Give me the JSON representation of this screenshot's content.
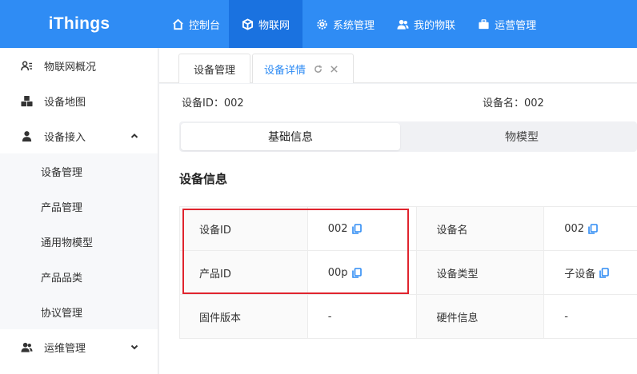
{
  "header": {
    "logo": "iThings",
    "nav": [
      {
        "label": "控制台",
        "icon": "home-icon"
      },
      {
        "label": "物联网",
        "icon": "cube-icon",
        "active": true
      },
      {
        "label": "系统管理",
        "icon": "gear-icon"
      },
      {
        "label": "我的物联",
        "icon": "users-icon"
      },
      {
        "label": "运营管理",
        "icon": "briefcase-icon"
      }
    ]
  },
  "sidebar": {
    "items": [
      {
        "label": "物联网概况",
        "icon": "user-list-icon"
      },
      {
        "label": "设备地图",
        "icon": "cubes-icon"
      },
      {
        "label": "设备接入",
        "icon": "user-icon",
        "expanded": true
      },
      {
        "label": "运维管理",
        "icon": "users-icon",
        "expanded": false
      }
    ],
    "sub_items": [
      "设备管理",
      "产品管理",
      "通用物模型",
      "产品品类",
      "协议管理"
    ]
  },
  "tabs": [
    {
      "label": "设备管理",
      "active": false
    },
    {
      "label": "设备详情",
      "active": true
    }
  ],
  "device_meta": {
    "id_label": "设备ID：",
    "id_value": "002",
    "name_label": "设备名：",
    "name_value": "002"
  },
  "segment": {
    "basic": "基础信息",
    "thing_model": "物模型"
  },
  "section_title": "设备信息",
  "info_table": {
    "rows": [
      [
        {
          "label": "设备ID",
          "value": "002",
          "copy": true
        },
        {
          "label": "设备名",
          "value": "002",
          "copy": true
        }
      ],
      [
        {
          "label": "产品ID",
          "value": "00p",
          "copy": true
        },
        {
          "label": "设备类型",
          "value": "子设备",
          "copy": true
        }
      ],
      [
        {
          "label": "固件版本",
          "value": "-",
          "copy": false
        },
        {
          "label": "硬件信息",
          "value": "-",
          "copy": false
        }
      ]
    ]
  },
  "colors": {
    "primary": "#2f8cf4",
    "primary_dark": "#1a72e0",
    "highlight": "#e0242e"
  }
}
